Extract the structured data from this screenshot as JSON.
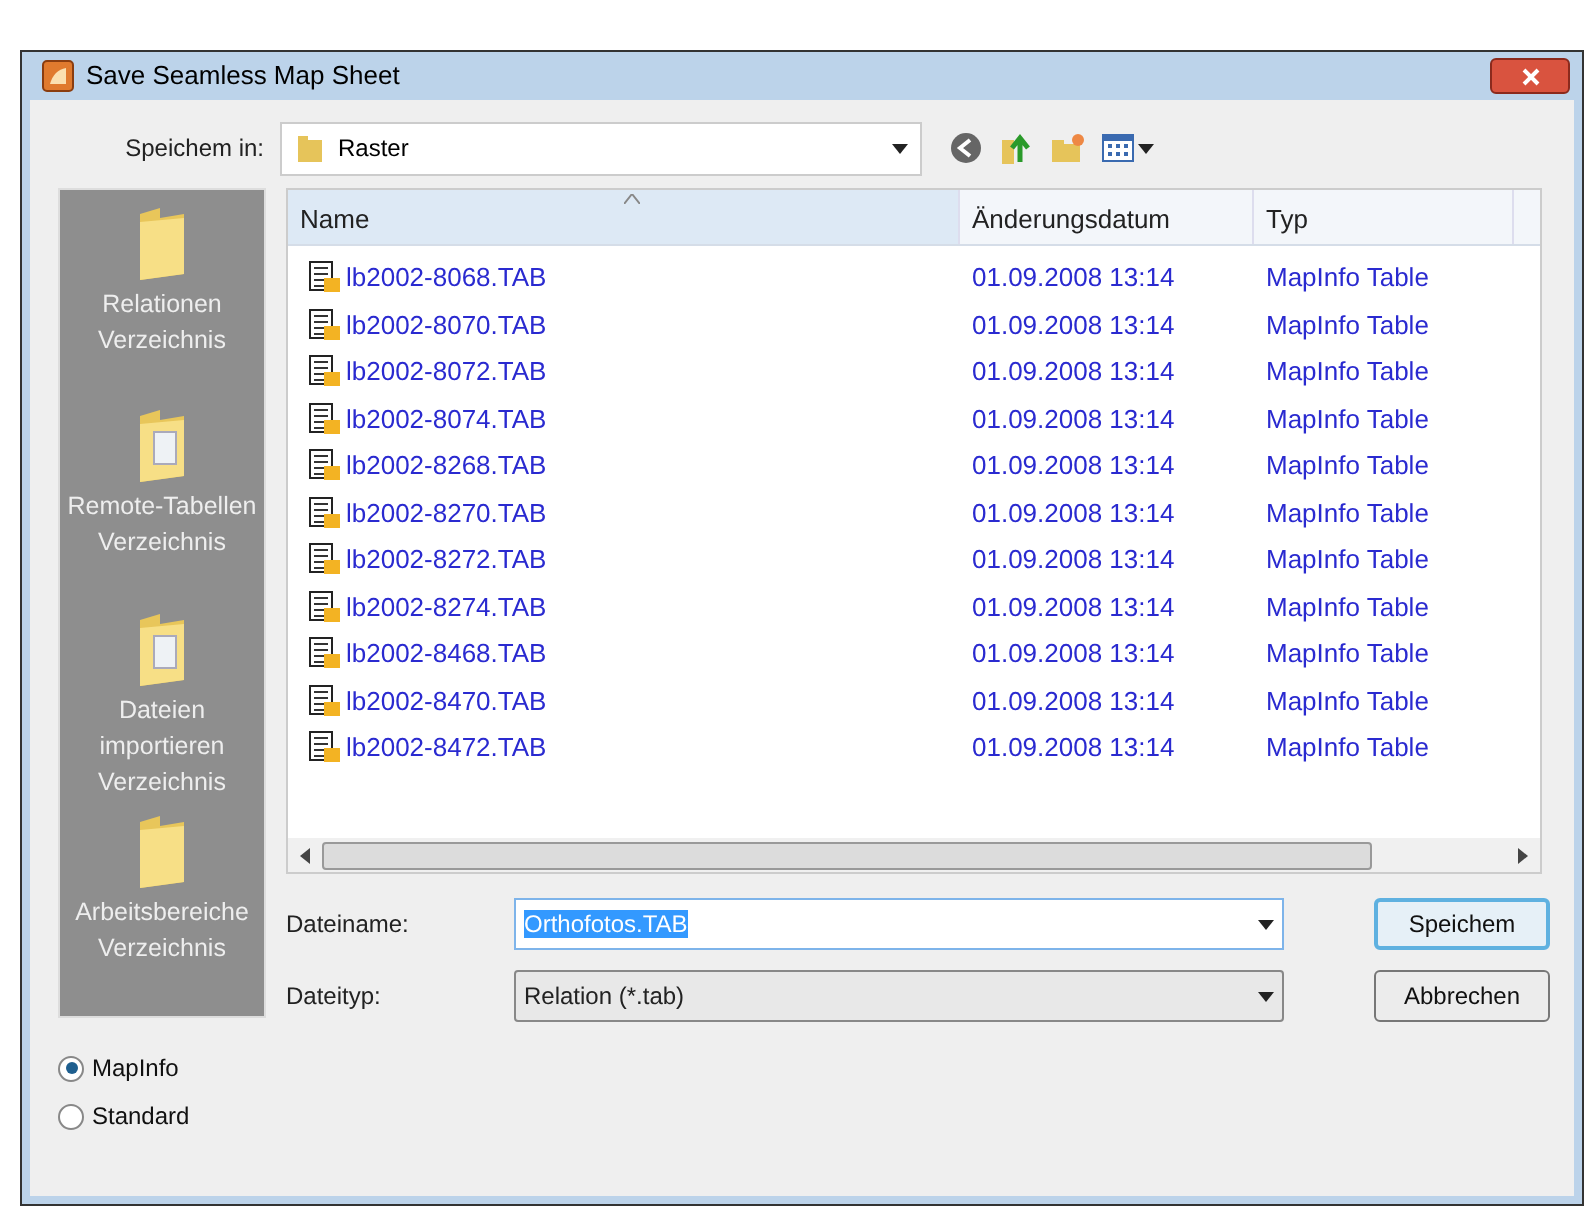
{
  "window": {
    "title": "Save Seamless Map Sheet"
  },
  "location": {
    "label": "Speichem in:",
    "value": "Raster"
  },
  "sidebar": {
    "items": [
      {
        "label": "Relationen Verzeichnis",
        "selected": false
      },
      {
        "label": "Remote-Tabellen Verzeichnis",
        "selected": false
      },
      {
        "label": "Dateien importieren Verzeichnis",
        "selected": false
      },
      {
        "label": "Arbeitsbereiche Verzeichnis",
        "selected": false
      }
    ]
  },
  "table": {
    "columns": [
      {
        "label": "Name",
        "sorted": true
      },
      {
        "label": "Änderungsdatum",
        "sorted": false
      },
      {
        "label": "Typ",
        "sorted": false
      }
    ],
    "rows": [
      [
        "lb2002-8068.TAB",
        "01.09.2008 13:14",
        "MapInfo Table"
      ],
      [
        "lb2002-8070.TAB",
        "01.09.2008 13:14",
        "MapInfo Table"
      ],
      [
        "lb2002-8072.TAB",
        "01.09.2008 13:14",
        "MapInfo Table"
      ],
      [
        "lb2002-8074.TAB",
        "01.09.2008 13:14",
        "MapInfo Table"
      ],
      [
        "lb2002-8268.TAB",
        "01.09.2008 13:14",
        "MapInfo Table"
      ],
      [
        "lb2002-8270.TAB",
        "01.09.2008 13:14",
        "MapInfo Table"
      ],
      [
        "lb2002-8272.TAB",
        "01.09.2008 13:14",
        "MapInfo Table"
      ],
      [
        "lb2002-8274.TAB",
        "01.09.2008 13:14",
        "MapInfo Table"
      ],
      [
        "lb2002-8468.TAB",
        "01.09.2008 13:14",
        "MapInfo Table"
      ],
      [
        "lb2002-8470.TAB",
        "01.09.2008 13:14",
        "MapInfo Table"
      ],
      [
        "lb2002-8472.TAB",
        "01.09.2008 13:14",
        "MapInfo Table"
      ]
    ]
  },
  "filename": {
    "label": "Dateiname:",
    "value": "Orthofotos.TAB"
  },
  "filetype": {
    "label": "Dateityp:",
    "value": "Relation (*.tab)"
  },
  "buttons": [
    {
      "label": "Speichem",
      "default": true
    },
    {
      "label": "Abbrechen",
      "default": false
    }
  ],
  "format": [
    {
      "label": "MapInfo",
      "selected": true
    },
    {
      "label": "Standard",
      "selected": false
    }
  ]
}
